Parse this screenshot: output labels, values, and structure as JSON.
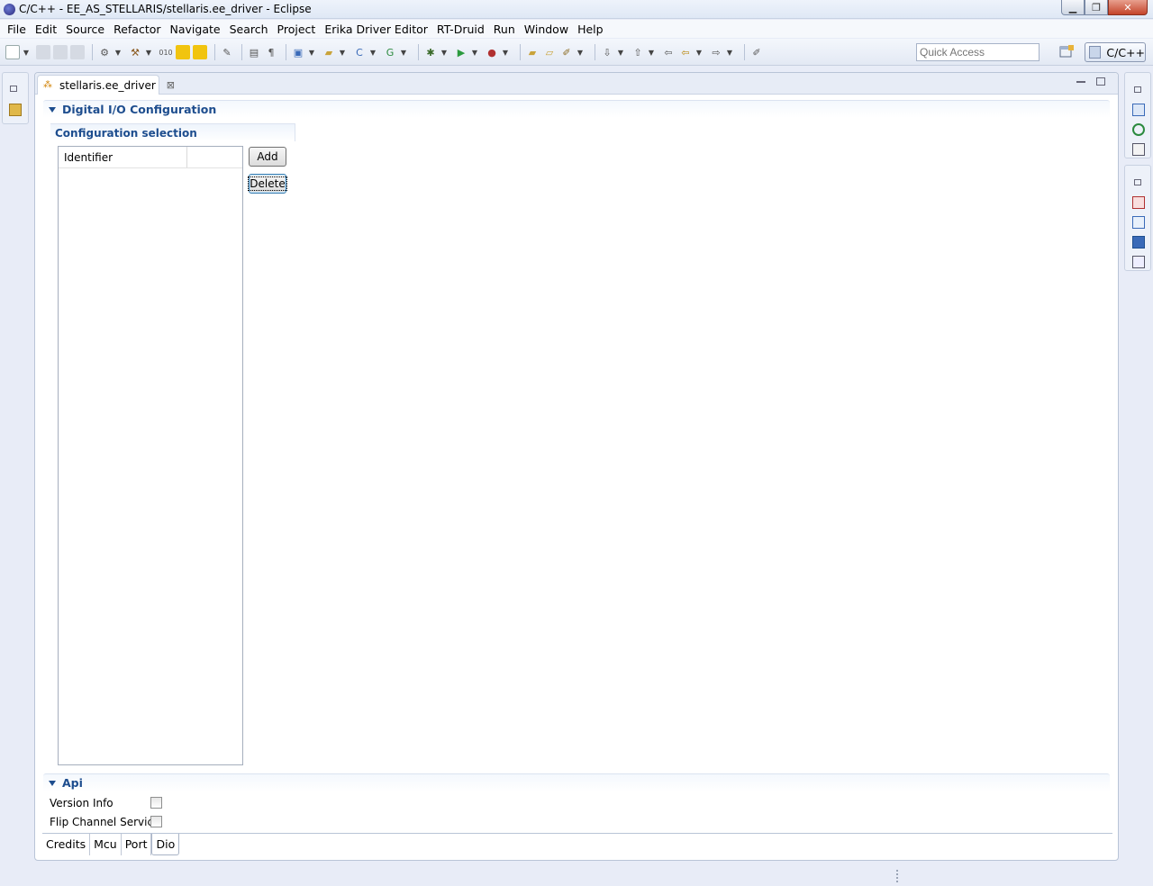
{
  "window": {
    "title": "C/C++ - EE_AS_STELLARIS/stellaris.ee_driver - Eclipse",
    "minimize_glyph": "▁",
    "maximize_glyph": "❐",
    "close_glyph": "✕"
  },
  "menu": [
    "File",
    "Edit",
    "Source",
    "Refactor",
    "Navigate",
    "Search",
    "Project",
    "Erika Driver Editor",
    "RT-Druid",
    "Run",
    "Window",
    "Help"
  ],
  "toolbar": {
    "quick_access_placeholder": "Quick Access",
    "perspective_label": "C/C++"
  },
  "editor": {
    "tab_label": "stellaris.ee_driver",
    "tab_icon": "ee-driver-file-icon",
    "tab_close_glyph": "⊠",
    "sections": {
      "dio": {
        "title": "Digital I/O Configuration",
        "config_selection": {
          "title": "Configuration selection",
          "table_columns": [
            "Identifier",
            ""
          ],
          "rows": [],
          "add_label": "Add",
          "delete_label": "Delete"
        }
      },
      "api": {
        "title": "Api",
        "options": [
          {
            "label": "Version Info",
            "checked": false
          },
          {
            "label": "Flip Channel Service",
            "checked": false
          }
        ]
      }
    },
    "page_tabs": [
      "Credits",
      "Mcu",
      "Port",
      "Dio"
    ],
    "active_page_tab": "Dio"
  },
  "colors": {
    "section_title": "#1d4d8e",
    "background": "#e8ecf7"
  }
}
